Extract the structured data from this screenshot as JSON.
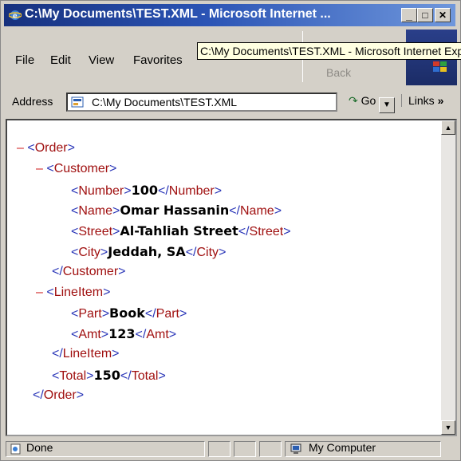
{
  "window": {
    "title": "C:\\My Documents\\TEST.XML - Microsoft Internet ...",
    "minimize": "_",
    "maximize": "□",
    "close": "✕"
  },
  "menu": [
    {
      "label": "File"
    },
    {
      "label": "Edit"
    },
    {
      "label": "View"
    },
    {
      "label": "Favorites"
    }
  ],
  "toolbar": {
    "back_label": "Back"
  },
  "tooltip": "C:\\My Documents\\TEST.XML - Microsoft Internet Explorer",
  "address": {
    "label": "Address",
    "value": "C:\\My Documents\\TEST.XML",
    "go": "Go",
    "links": "Links"
  },
  "xml_lines": [
    {
      "indent": 0,
      "collapsible": true,
      "open": "Order"
    },
    {
      "indent": 1,
      "collapsible": true,
      "open": "Customer"
    },
    {
      "indent": 2,
      "open": "Number",
      "value": "100",
      "close": "Number"
    },
    {
      "indent": 2,
      "open": "Name",
      "value": "Omar Hassanin",
      "close": "Name"
    },
    {
      "indent": 2,
      "open": "Street",
      "value": "Al-Tahliah Street",
      "close": "Street"
    },
    {
      "indent": 2,
      "open": "City",
      "value": "Jeddah, SA",
      "close": "City"
    },
    {
      "indent": 1,
      "closeonly": "Customer"
    },
    {
      "indent": 1,
      "collapsible": true,
      "open": "LineItem"
    },
    {
      "indent": 2,
      "open": "Part",
      "value": "Book",
      "close": "Part"
    },
    {
      "indent": 2,
      "open": "Amt",
      "value": "123",
      "close": "Amt"
    },
    {
      "indent": 1,
      "closeonly": "LineItem"
    },
    {
      "indent": 1,
      "open": "Total",
      "value": "150",
      "close": "Total"
    },
    {
      "indent": 0,
      "closeonly": "Order"
    }
  ],
  "status": {
    "left": "Done",
    "zone": "My Computer"
  },
  "colors": {
    "title_start": "#17317e",
    "title_end": "#6f97dc",
    "tag": "#a01010",
    "bracket": "#2a36b8",
    "minus": "#d02020"
  }
}
